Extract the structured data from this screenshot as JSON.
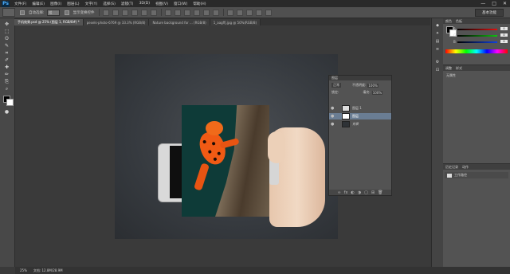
{
  "app": {
    "logo": "Ps"
  },
  "menu": [
    "文件(F)",
    "编辑(E)",
    "图像(I)",
    "图层(L)",
    "文字(Y)",
    "选择(S)",
    "滤镜(T)",
    "3D(D)",
    "视图(V)",
    "窗口(W)",
    "帮助(H)"
  ],
  "window_controls": [
    "—",
    "□",
    "✕"
  ],
  "options_bar": {
    "auto_select_label": "自动选择:",
    "auto_select_value": "组",
    "show_transform_label": "显示变换控件",
    "workspace": "基本功能"
  },
  "tabs": [
    "手机效果.psd @ 25% (图层 1, RGB/8#) *",
    "pexels-photo-6769 @ 33.3% (RGB/8)",
    "Nature background for ... (RGB/8)",
    "1_aagffj.jpg @ 50%(RGB/8)"
  ],
  "active_tab": 0,
  "toolbar_icons": [
    "move-icon",
    "marquee-icon",
    "lasso-icon",
    "quick-select-icon",
    "crop-icon",
    "eyedropper-icon",
    "healing-icon",
    "brush-icon",
    "stamp-icon",
    "history-brush-icon",
    "eraser-icon",
    "gradient-icon",
    "blur-icon",
    "dodge-icon",
    "pen-icon",
    "type-icon",
    "path-select-icon",
    "shape-icon",
    "hand-icon",
    "zoom-icon"
  ],
  "tool_glyphs": [
    "✥",
    "⬚",
    "ʘ",
    "✎",
    "⌗",
    "✐",
    "✚",
    "✏",
    "⎘",
    "↺",
    "◫",
    "▦",
    "◌",
    "●",
    "✒",
    "T",
    "➤",
    "▭",
    "✋",
    "⌕"
  ],
  "layers_panel": {
    "title": "图层",
    "kind_label": "正常",
    "opacity_label": "不透明度:",
    "opacity_value": "100%",
    "lock_label": "锁定:",
    "fill_label": "填充:",
    "fill_value": "100%",
    "layers": [
      {
        "name": "图层 1",
        "visible": true
      },
      {
        "name": "图层",
        "visible": true
      },
      {
        "name": "背景",
        "visible": true
      }
    ],
    "footer_icons": [
      "∞",
      "fx",
      "◐",
      "◑",
      "▢",
      "⊞",
      "🗑"
    ]
  },
  "color_panel": {
    "tabs": [
      "颜色",
      "色板"
    ],
    "sliders": [
      {
        "label": "R",
        "value": "0",
        "color": "#d01010"
      },
      {
        "label": "G",
        "value": "0",
        "color": "#10b010"
      },
      {
        "label": "B",
        "value": "0",
        "color": "#1040d0"
      }
    ]
  },
  "adjust_panel": {
    "tabs": [
      "调整",
      "样式"
    ],
    "title": "无属性"
  },
  "history_panel": {
    "tabs": [
      "历史记录",
      "动作"
    ],
    "item": "工作路径"
  },
  "right_icons": [
    "◆",
    "✦",
    "▤",
    "≡",
    "⚙",
    "⊡",
    "◧",
    "▥"
  ],
  "status": {
    "zoom": "25%",
    "doc": "文档: 12.8M/28.9M"
  }
}
